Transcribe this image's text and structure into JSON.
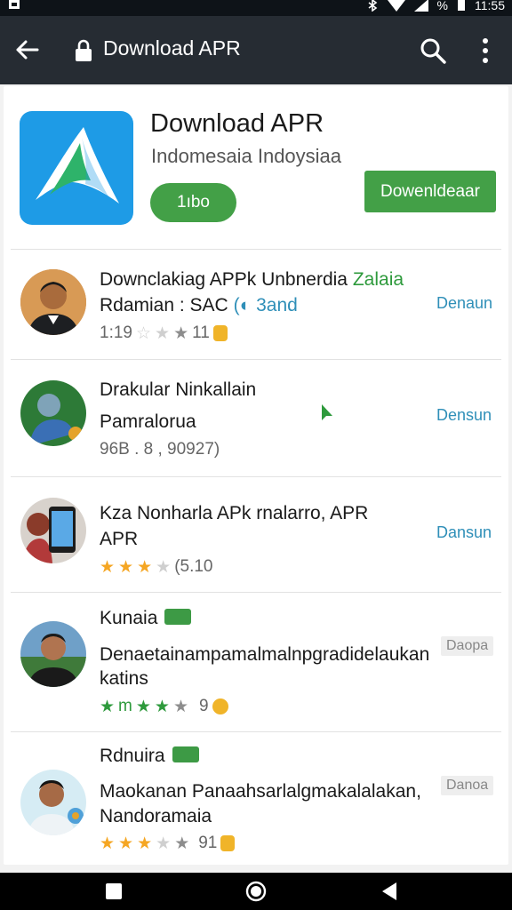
{
  "status_bar": {
    "time": "11:55",
    "battery": "%"
  },
  "app_bar": {
    "title": "Download APR"
  },
  "app": {
    "title": "Download APR",
    "subtitle": "Indomesaia Indoysiaa",
    "pill_label": "1ıbo",
    "install_label": "Dowenldeaar"
  },
  "results": [
    {
      "name": "Downclakiag APPk Unbnerdia",
      "name_suffix": "Zalaia",
      "line2": "Rdamian : SAC",
      "line2_suffix": "(◐ 3and",
      "meta_prefix": "1:19",
      "meta_suffix": "11",
      "action": "Denaun"
    },
    {
      "name": "Drakular Ninkallain",
      "line2": "Pamralorua",
      "meta": "96B . 8 , 90927)",
      "action": "Densun"
    },
    {
      "name": "Kza Nonharla APk rnalarro, APR",
      "line2": "APR",
      "meta_suffix": "(5.10",
      "action": "Dansun"
    },
    {
      "name": "Kunaia",
      "line2": "Denaetainampamalmalnpgradidelaukan",
      "line3": "katins",
      "meta_mid": "m",
      "meta_suffix": "9",
      "action": "Daopa"
    },
    {
      "name": "Rdnuira",
      "line2": "Maokanan Panaahsarlalgmakalalakan,",
      "line3": "Nandoramaia",
      "meta_suffix": "91",
      "action": "Danoa"
    }
  ],
  "colors": {
    "accent_green": "#43a047",
    "link_blue": "#2f8fb8",
    "app_bar": "#262c33",
    "icon_tile": "#1e9be6"
  }
}
